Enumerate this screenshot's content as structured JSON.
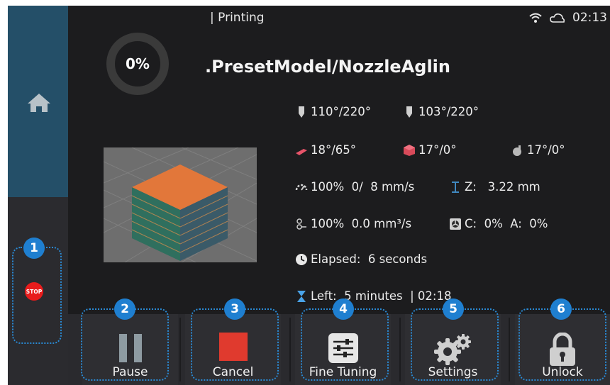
{
  "status": {
    "state": "| Printing",
    "time": "02:13",
    "wifi_icon": "wifi-icon",
    "cloud_icon": "cloud-icon"
  },
  "progress": {
    "text": "0%",
    "fraction": 0.0
  },
  "model": {
    "name": ".PresetModel/NozzleAglin"
  },
  "info": {
    "nozzle1": "110°/220°",
    "nozzle2": "103°/220°",
    "bed": "18°/65°",
    "chamber": "17°/0°",
    "aux": "17°/0°",
    "speed": "100%  0/  8 mm/s",
    "z": "Z:   3.22 mm",
    "flow": "100%  0.0 mm³/s",
    "fans": "C:  0%  A:  0%",
    "elapsed": "Elapsed:  6 seconds",
    "left": "Left:  5 minutes  | 02:18"
  },
  "sidebar": {
    "stop_label": "STOP"
  },
  "buttons": {
    "pause": "Pause",
    "cancel": "Cancel",
    "fine_tuning": "Fine Tuning",
    "settings": "Settings",
    "unlock": "Unlock"
  },
  "callouts": [
    "1",
    "2",
    "3",
    "4",
    "5",
    "6"
  ],
  "colors": {
    "accent": "#1f7fd0",
    "cancel": "#e03a2e",
    "stop": "#e81c1c",
    "home_panel": "#244f68",
    "model_top": "#e2773a"
  }
}
